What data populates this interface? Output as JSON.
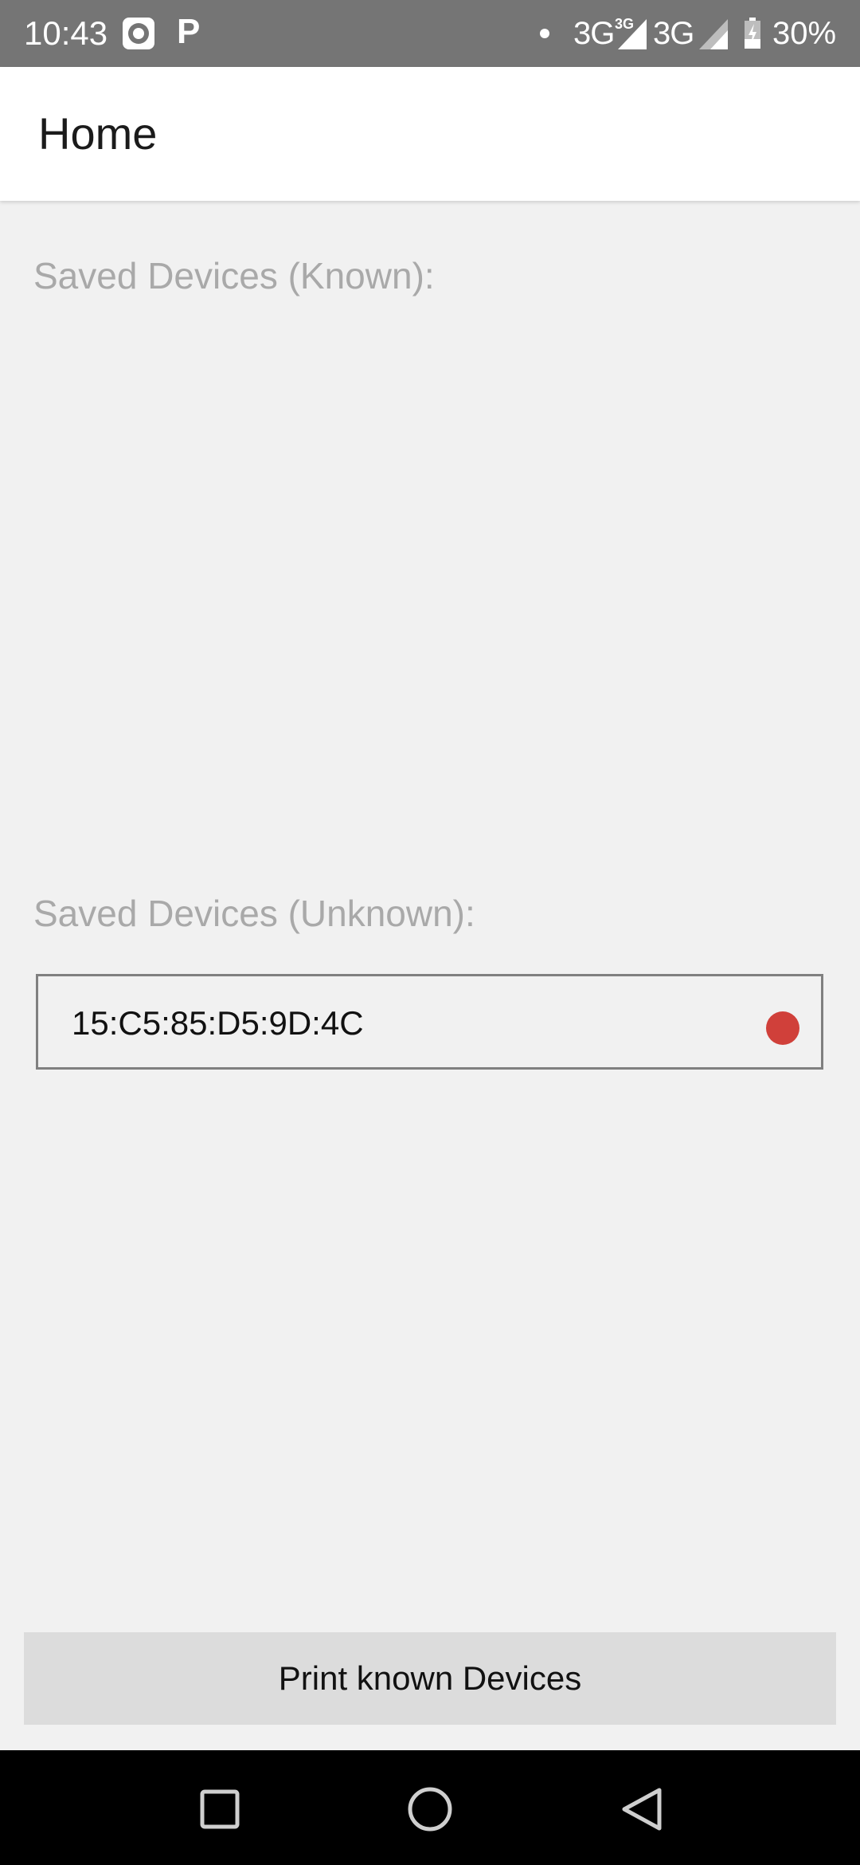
{
  "status_bar": {
    "time": "10:43",
    "p_icon": "P",
    "network1": "3G",
    "network1_sup": "3G",
    "network2": "3G",
    "battery": "30%"
  },
  "app_bar": {
    "title": "Home"
  },
  "main": {
    "known_label": "Saved Devices (Known):",
    "unknown_label": "Saved Devices (Unknown):",
    "unknown_devices": [
      {
        "mac": "15:C5:85:D5:9D:4C",
        "status_color": "#d0403a"
      }
    ]
  },
  "actions": {
    "print_button": "Print known Devices"
  },
  "nav": {
    "recents_icon": "square-icon",
    "home_icon": "circle-icon",
    "back_icon": "triangle-back-icon"
  }
}
